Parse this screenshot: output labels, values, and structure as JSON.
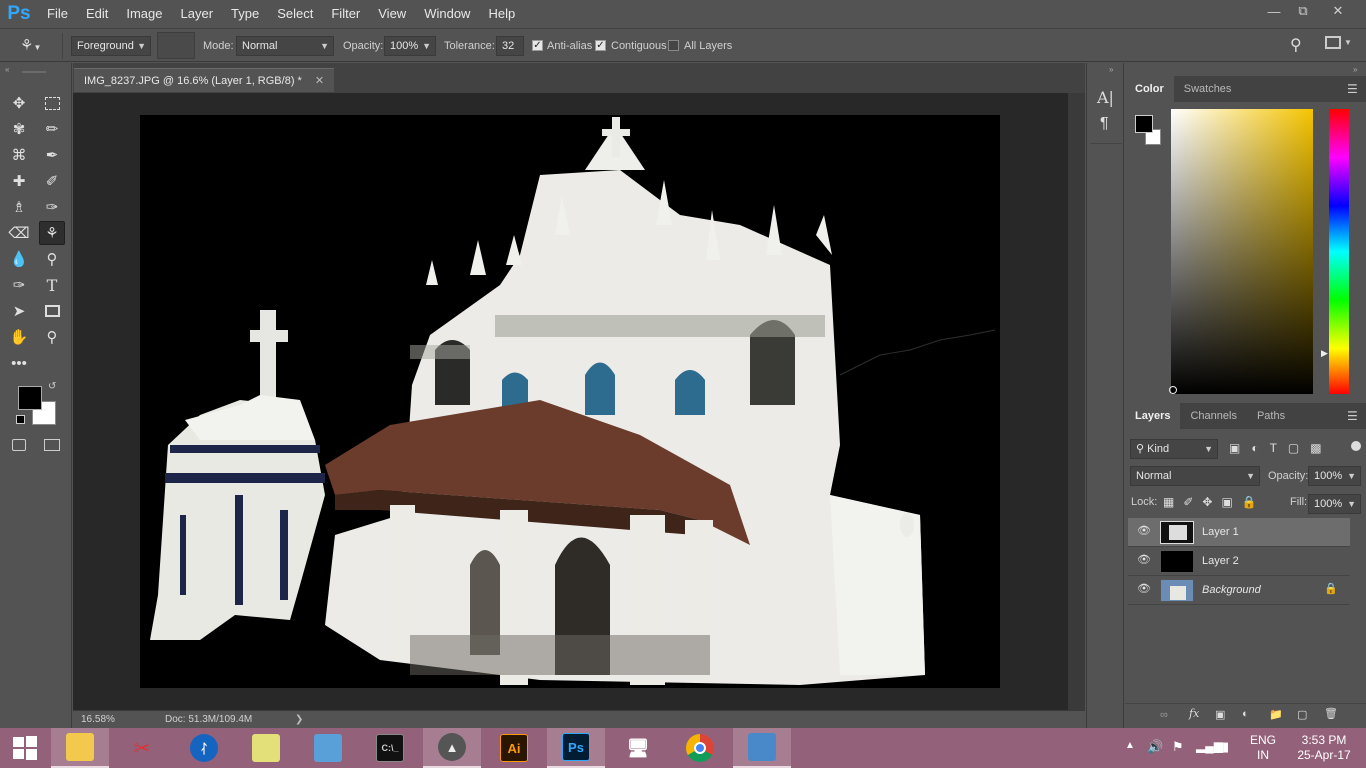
{
  "app": {
    "logo": "Ps",
    "menu": [
      "File",
      "Edit",
      "Image",
      "Layer",
      "Type",
      "Select",
      "Filter",
      "View",
      "Window",
      "Help"
    ]
  },
  "options": {
    "fill_source": "Foreground",
    "mode_label": "Mode:",
    "mode_value": "Normal",
    "opacity_label": "Opacity:",
    "opacity_value": "100%",
    "tolerance_label": "Tolerance:",
    "tolerance_value": "32",
    "anti_alias": {
      "label": "Anti-alias",
      "checked": true
    },
    "contiguous": {
      "label": "Contiguous",
      "checked": true
    },
    "all_layers": {
      "label": "All Layers",
      "checked": false
    }
  },
  "document": {
    "tab_title": "IMG_8237.JPG @ 16.6% (Layer 1, RGB/8) *",
    "zoom": "16.58%",
    "doc_size": "Doc: 51.3M/109.4M"
  },
  "color_panel": {
    "tabs": [
      "Color",
      "Swatches"
    ],
    "foreground": "#000000",
    "background": "#ffffff",
    "hue_color": "#f5c400"
  },
  "layers_panel": {
    "tabs": [
      "Layers",
      "Channels",
      "Paths"
    ],
    "filter_kind": "Kind",
    "blend_mode": "Normal",
    "opacity_label": "Opacity:",
    "opacity_value": "100%",
    "lock_label": "Lock:",
    "fill_label": "Fill:",
    "fill_value": "100%",
    "layers": [
      {
        "name": "Layer 1",
        "selected": true,
        "visible": true
      },
      {
        "name": "Layer 2",
        "selected": false,
        "visible": true
      },
      {
        "name": "Background",
        "selected": false,
        "visible": true,
        "locked": true
      }
    ]
  },
  "taskbar": {
    "apps": [
      "start",
      "file-explorer",
      "snipping-tool",
      "bluetooth",
      "sticky-notes",
      "control-panel",
      "command-prompt",
      "unknown-app",
      "illustrator",
      "photoshop",
      "network-setup",
      "chrome",
      "video-app"
    ],
    "illustrator_label": "Ai",
    "photoshop_label": "Ps",
    "lang_line1": "ENG",
    "lang_line2": "IN",
    "time": "3:53 PM",
    "date": "25-Apr-17"
  },
  "colors": {
    "ui_bg": "#535353",
    "dark_bg": "#282828",
    "ps_blue": "#31a8ff",
    "ai_orange": "#ff9a00",
    "taskbar": "#94617a"
  }
}
